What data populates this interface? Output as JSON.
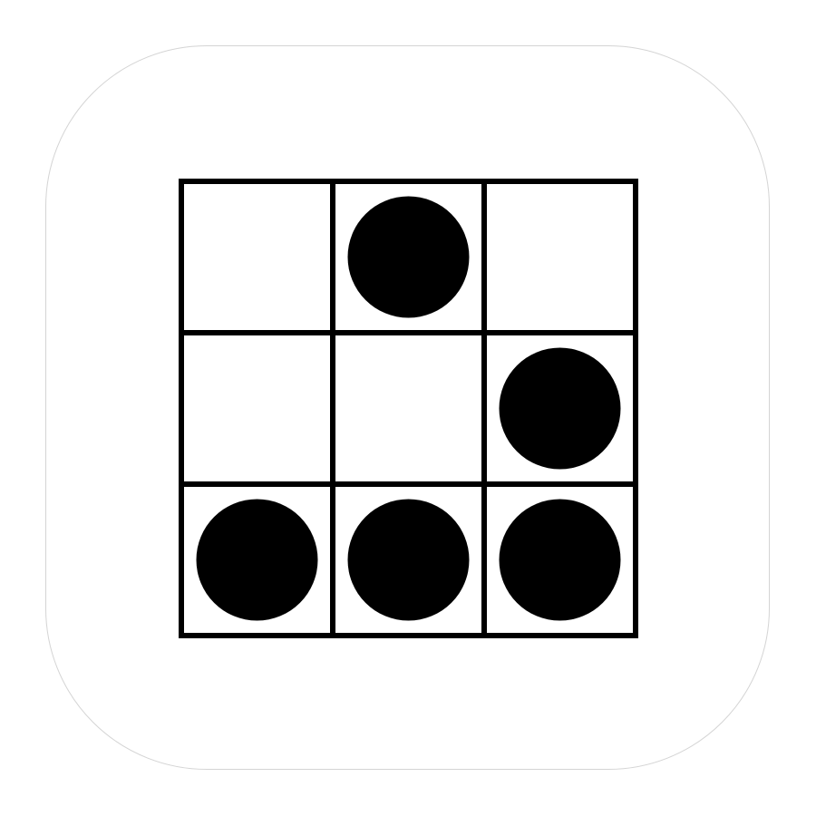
{
  "icon": {
    "name": "glider-icon",
    "background_color": "#ffffff",
    "border_color": "#d4d4d4",
    "line_color": "#000000",
    "cell_fill_color": "#ffffff",
    "dot_color": "#000000"
  },
  "grid": {
    "rows": 3,
    "cols": 3,
    "cells": [
      [
        0,
        1,
        0
      ],
      [
        0,
        0,
        1
      ],
      [
        1,
        1,
        1
      ]
    ]
  }
}
